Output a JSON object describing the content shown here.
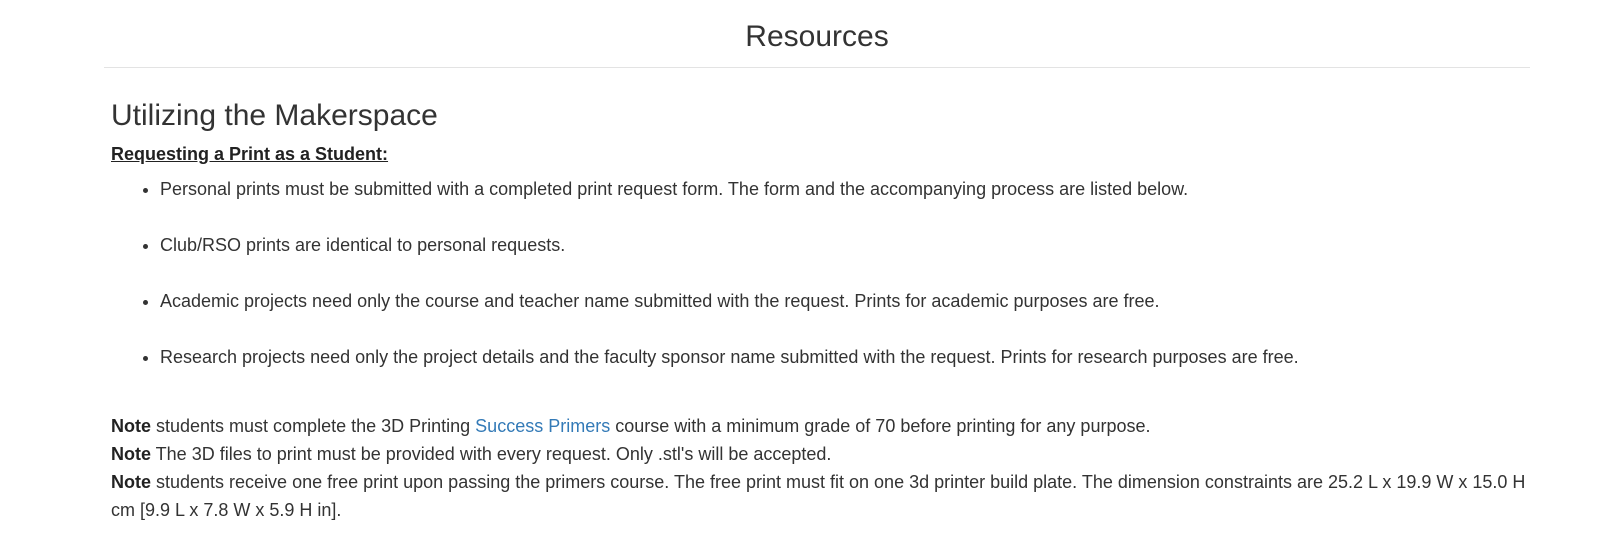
{
  "header": {
    "title": "Resources"
  },
  "section": {
    "title": "Utilizing the Makerspace",
    "subheading": "Requesting a Print as a Student:",
    "bullets": [
      "Personal prints must be submitted with a completed print request form. The form and the accompanying process are listed below.",
      "Club/RSO prints are identical to personal requests.",
      "Academic projects need only the course and teacher name submitted with the request. Prints for academic purposes are free.",
      "Research projects need only the project details and the faculty sponsor name submitted with the request. Prints for research purposes are free."
    ]
  },
  "notes": {
    "note1": {
      "label": "Note",
      "before_link": " students must complete the 3D Printing ",
      "link_text": "Success Primers",
      "after_link": " course with a minimum grade of 70 before printing for any purpose."
    },
    "note2": {
      "label": "Note",
      "text": " The 3D files to print must be provided with every request. Only .stl's will be accepted."
    },
    "note3": {
      "label": "Note",
      "text": " students receive one free print upon passing the primers course. The free print must fit on one 3d printer build plate. The dimension constraints are 25.2 L x 19.9 W x 15.0 H cm [9.9 L x 7.8 W x 5.9 H in]."
    }
  },
  "colors": {
    "text": "#333333",
    "link": "#337ab7",
    "divider": "#e3e3e3"
  }
}
